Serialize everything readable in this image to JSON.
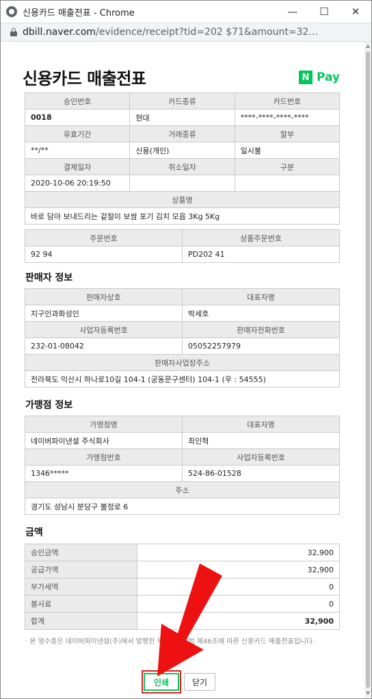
{
  "window": {
    "title": "신용카드 매출전표 - Chrome"
  },
  "address_bar": {
    "host": "dbill.naver.com",
    "path": "/evidence/receipt?tid=202                        $71&amount=32..."
  },
  "receipt": {
    "title": "신용카드 매출전표",
    "logo": {
      "n": "N",
      "pay": "Pay"
    },
    "card_info": {
      "approval_no_label": "승인번호",
      "approval_no": "0018",
      "card_type_label": "카드종류",
      "card_type": "현대",
      "card_no_label": "카드번호",
      "card_no": "****-****-****-****",
      "expiry_label": "유효기간",
      "expiry": "**/**",
      "txn_type_label": "거래종류",
      "txn_type": "신용(개인)",
      "installment_label": "할부",
      "installment": "일시불",
      "pay_date_label": "결제일자",
      "pay_date": "2020-10-06 20:19:50",
      "cancel_date_label": "취소일자",
      "cancel_date": "",
      "category_label": "구분",
      "category": "",
      "product_label": "상품명",
      "product": "바로 담아 보내드리는 겉절이 보쌈 포기 김치 모음 3Kg 5Kg",
      "order_no_label": "주문번호",
      "order_no": "92              94",
      "product_order_no_label": "상품주문번호",
      "product_order_no": "PD202                          41"
    },
    "seller": {
      "heading": "판매자 정보",
      "name_label": "판매자상호",
      "name": "지구인과화성인",
      "ceo_label": "대표자명",
      "ceo": "박세호",
      "biz_no_label": "사업자등록번호",
      "biz_no": "232-01-08042",
      "phone_label": "판매자전화번호",
      "phone": "05052257979",
      "address_label": "판매자사업장주소",
      "address": "전라북도 익산시 하나로10길 104-1 (궁동문구센터) 104-1 (우 : 54555)"
    },
    "merchant": {
      "heading": "가맹점 정보",
      "name_label": "가맹점명",
      "name": "네이버파이낸셜 주식회사",
      "ceo_label": "대표자명",
      "ceo": "최인혁",
      "merchant_no_label": "가맹점번호",
      "merchant_no": "1346*****",
      "biz_no_label": "사업자등록번호",
      "biz_no": "524-86-01528",
      "address_label": "주소",
      "address": "경기도 성남시 분당구 불정로 6"
    },
    "amount": {
      "heading": "금액",
      "rows": [
        {
          "label": "승인금액",
          "value": "32,900"
        },
        {
          "label": "공급가액",
          "value": "32,900"
        },
        {
          "label": "부가세액",
          "value": "0"
        },
        {
          "label": "봉사료",
          "value": "0"
        }
      ],
      "total_label": "합계",
      "total": "32,900"
    },
    "notice": "· 본 영수증은 네이버파이낸셜(주)에서 발행한 부가가치세법 제46조에 따른 신용카드 매출전표입니다.",
    "print_button": "인쇄",
    "close_button": "닫기"
  },
  "colors": {
    "brand_green": "#03c75a",
    "highlight_red": "#e02020"
  }
}
